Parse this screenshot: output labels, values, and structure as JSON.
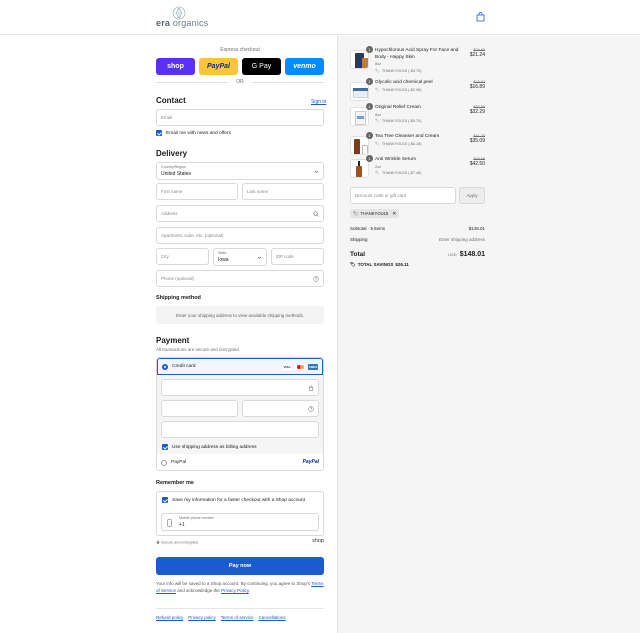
{
  "header": {
    "brand_prefix": "era",
    "brand_suffix": "organics"
  },
  "express": {
    "title": "Express checkout",
    "shop_label": "shop",
    "paypal_label": "PayPal",
    "gpay_label": "G Pay",
    "venmo_label": "venmo",
    "or_label": "OR"
  },
  "contact": {
    "heading": "Contact",
    "signin_label": "Sign in",
    "email_placeholder": "Email",
    "news_label": "Email me with news and offers"
  },
  "delivery": {
    "heading": "Delivery",
    "country_label": "Country/Region",
    "country_value": "United States",
    "first_name": "First name",
    "last_name": "Last name",
    "address": "Address",
    "apartment": "Apartment, suite, etc. (optional)",
    "city": "City",
    "state_label": "State",
    "state_value": "Iowa",
    "zip": "ZIP code",
    "phone": "Phone (optional)"
  },
  "shipping": {
    "heading": "Shipping method",
    "message": "Enter your shipping address to view available shipping methods."
  },
  "payment": {
    "heading": "Payment",
    "subtitle": "All transactions are secure and encrypted.",
    "credit_card_label": "Credit card",
    "billing_label": "Use shipping address as billing address",
    "paypal_label": "PayPal",
    "card_brands": [
      "VISA",
      "MC",
      "AMEX"
    ]
  },
  "remember": {
    "heading": "Remember me",
    "save_label": "Save my information for a faster checkout with a Shop account",
    "mobile_label": "Mobile phone number",
    "mobile_prefix": "+1",
    "secure_label": "Secure and encrypted",
    "shop_brand": "shop"
  },
  "pay_now_label": "Pay now",
  "legal": {
    "text": "Your info will be saved to a Shop account. By continuing, you agree to Shop's",
    "terms": "Terms of Service",
    "and": "and acknowledge the",
    "privacy": "Privacy Policy",
    "end": "."
  },
  "footer_links": [
    "Refund policy",
    "Privacy policy",
    "Terms of service",
    "Cancellations"
  ],
  "items": [
    {
      "qty": "1",
      "name": "Hypochlorous Acid Spray For Face and Body - Happy Skin",
      "variant": "8oz",
      "discount": "THANKYOU15 (-$3.75)",
      "original": "$24.99",
      "price": "$21.24"
    },
    {
      "qty": "1",
      "name": "Glycolic acid chemical peel",
      "variant": "",
      "discount": "THANKYOU15 (-$2.98)",
      "original": "$19.87",
      "price": "$16.89"
    },
    {
      "qty": "1",
      "name": "Original Relief Cream",
      "variant": "8oz",
      "discount": "THANKYOU15 (-$5.70)",
      "original": "$37.99",
      "price": "$32.29"
    },
    {
      "qty": "1",
      "name": "Tea Tree Cleanser and Cream",
      "variant": "",
      "discount": "THANKYOU15 (-$6.18)",
      "original": "$41.28",
      "price": "$35.09"
    },
    {
      "qty": "1",
      "name": "Anti Wrinkle Serum",
      "variant": "2oz",
      "discount": "THANKYOU15 (-$7.48)",
      "original": "$49.98",
      "price": "$42.50"
    }
  ],
  "summary": {
    "discount_placeholder": "Discount code or gift card",
    "apply_label": "Apply",
    "applied_code": "THANKYOU15",
    "subtotal_label": "Subtotal · 5 items",
    "subtotal_value": "$148.01",
    "shipping_label": "Shipping",
    "shipping_value": "Enter shipping address",
    "total_label": "Total",
    "currency": "USD",
    "total_value": "$148.01",
    "savings_label": "TOTAL SAVINGS",
    "savings_value": "$26.11"
  },
  "colors": {
    "primary": "#1a5bd1",
    "shop": "#5a31f4",
    "paypal": "#ffc439",
    "venmo": "#008cff"
  }
}
